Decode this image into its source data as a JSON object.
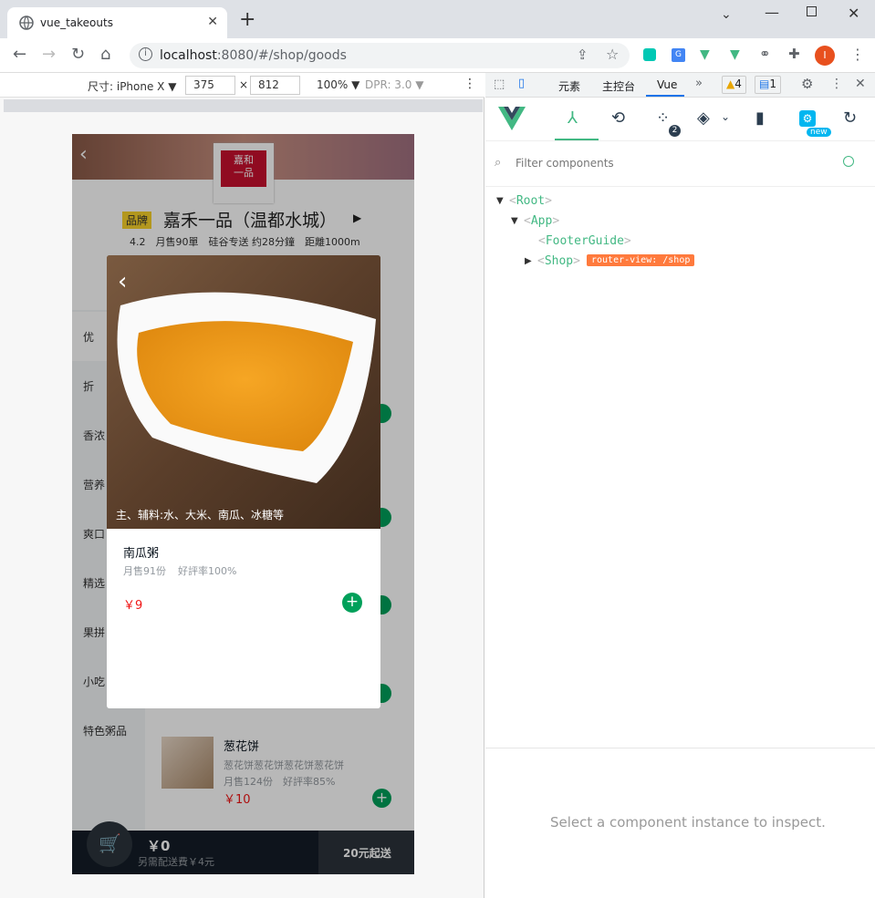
{
  "browser": {
    "tab_title": "vue_takeouts",
    "url_host": "localhost",
    "url_path": ":8080/#/shop/goods",
    "new_tab": "+",
    "profile_initial": "I"
  },
  "device_toolbar": {
    "device_label": "尺寸: iPhone X ▼",
    "width": "375",
    "times": "×",
    "height": "812",
    "zoom": "100% ▼",
    "dpr": "DPR: 3.0 ▼"
  },
  "shop": {
    "brand_badge": "品牌",
    "name": "嘉禾一品（温都水城）",
    "info": "4.2　月售90單　硅谷专送 约28分鐘　距離1000m",
    "menu": [
      "优",
      "折",
      "香浓",
      "营养",
      "爽口",
      "精选",
      "果拼",
      "小吃",
      "特色粥品"
    ],
    "list_item": {
      "name": "葱花饼",
      "desc": "葱花饼葱花饼葱花饼葱花饼",
      "sales": "月售124份　好評率85%",
      "price": "￥10"
    },
    "cart": {
      "price": "￥0",
      "delivery": "另需配送費￥4元",
      "min_order": "20元起送"
    }
  },
  "food_modal": {
    "ingredients": "主、辅料:水、大米、南瓜、冰糖等",
    "name": "南瓜粥",
    "sales": "月售91份",
    "rating": "好評率100%",
    "price": "￥9"
  },
  "devtools": {
    "tabs": [
      "元素",
      "主控台",
      "Vue"
    ],
    "active_tab": "Vue",
    "warnings": "4",
    "messages": "1",
    "timeline_badge": "2",
    "new_badge": "new",
    "filter_placeholder": "Filter components",
    "tree": [
      {
        "name": "Root"
      },
      {
        "name": "App"
      },
      {
        "name": "FooterGuide"
      },
      {
        "name": "Shop",
        "tag": "router-view: /shop"
      }
    ],
    "inspect_message": "Select a component instance to inspect."
  },
  "colors": {
    "vue_green": "#42b883",
    "price_red": "#f01414",
    "add_green": "#00a05a",
    "router_tag": "#ff7a3d"
  }
}
